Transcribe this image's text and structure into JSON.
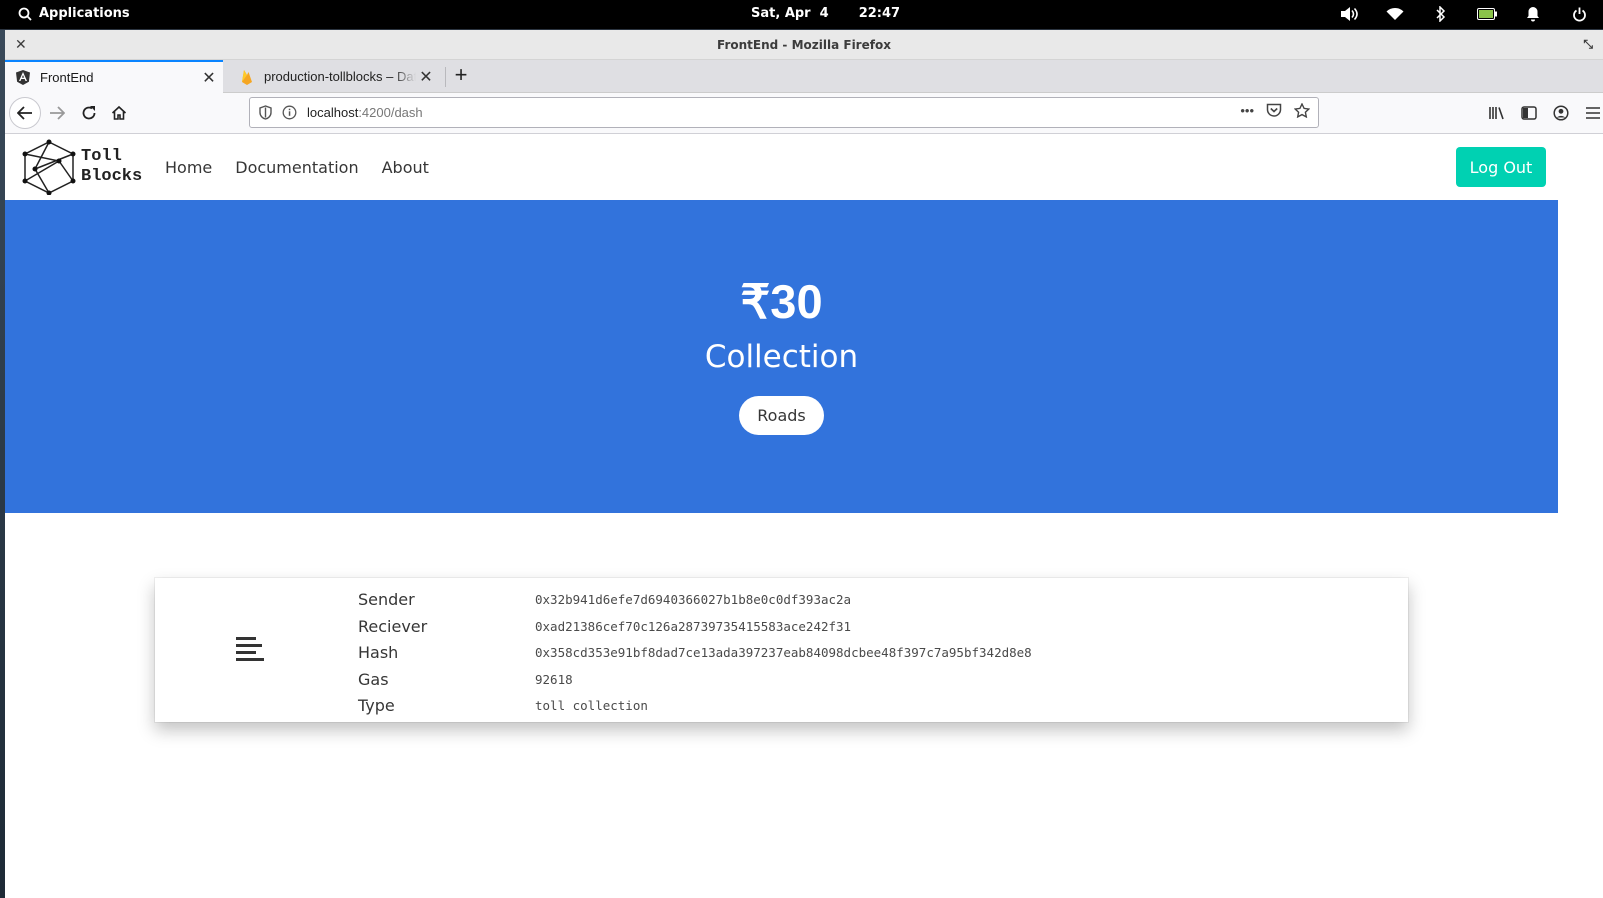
{
  "topbar": {
    "applications_label": "Applications",
    "date": "Sat, Apr  4",
    "time": "22:47"
  },
  "window": {
    "title": "FrontEnd - Mozilla Firefox"
  },
  "tabs": [
    {
      "label": "FrontEnd",
      "favicon": "angular-icon",
      "active": true
    },
    {
      "label": "production-tollblocks – Datab",
      "favicon": "firebase-icon",
      "active": false
    }
  ],
  "urlbar": {
    "host": "localhost",
    "path": ":4200/dash"
  },
  "site": {
    "logo_line1": "Toll",
    "logo_line2": "Blocks",
    "nav": [
      "Home",
      "Documentation",
      "About"
    ],
    "logout_label": "Log Out"
  },
  "hero": {
    "amount": "₹30",
    "subtitle": "Collection",
    "roads_label": "Roads",
    "background_color": "#3273dc"
  },
  "transaction": {
    "labels": [
      "Sender",
      "Reciever",
      "Hash",
      "Gas",
      "Type"
    ],
    "values": [
      "0x32b941d6efe7d6940366027b1b8e0c0df393ac2a",
      "0xad21386cef70c126a287397354 15583ace242f31",
      "0x358cd353e91bf8dad7ce13ada397237eab84098dcbee48f397c7a95bf342d8e8",
      "92618",
      "toll collection"
    ]
  },
  "colors": {
    "accent_teal": "#00d1b2",
    "hero_blue": "#3273dc",
    "tab_active_blue": "#0a84ff"
  }
}
